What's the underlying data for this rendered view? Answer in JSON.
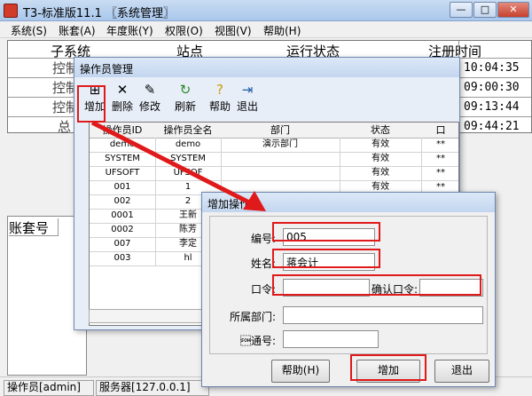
{
  "window": {
    "title": "T3-标准版11.1 〖系统管理〗",
    "min_label": "—",
    "max_label": "□",
    "close_label": "✕"
  },
  "menu": [
    "系统(S)",
    "账套(A)",
    "年度账(Y)",
    "权限(O)",
    "视图(V)",
    "帮助(H)"
  ],
  "main_table": {
    "headers": [
      "子系统",
      "站点",
      "运行状态",
      "注册时间"
    ],
    "row_labels": [
      "控制",
      "控制",
      "控制",
      "总"
    ],
    "times": [
      "10:04:35",
      "09:00:30",
      "09:13:44",
      "09:44:21"
    ]
  },
  "lower_table": {
    "header": "账套号"
  },
  "status_bar": {
    "operator": "操作员[admin]",
    "server": "服务器[127.0.0.1]"
  },
  "operator_dialog": {
    "title": "操作员管理",
    "toolbar": [
      {
        "label": "增加",
        "icon": "add-icon"
      },
      {
        "label": "删除",
        "icon": "delete-icon"
      },
      {
        "label": "修改",
        "icon": "edit-icon"
      },
      {
        "label": "刷新",
        "icon": "refresh-icon"
      },
      {
        "label": "帮助",
        "icon": "help-icon"
      },
      {
        "label": "退出",
        "icon": "exit-icon"
      }
    ],
    "columns": [
      "操作员ID",
      "操作员全名",
      "部门",
      "状态",
      "口"
    ],
    "rows": [
      [
        "demo",
        "demo",
        "演示部门",
        "有效",
        "**"
      ],
      [
        "SYSTEM",
        "SYSTEM",
        "",
        "有效",
        "**"
      ],
      [
        "UFSOFT",
        "UFSOF",
        "",
        "有效",
        "**"
      ],
      [
        "001",
        "1",
        "",
        "有效",
        "**"
      ],
      [
        "002",
        "2",
        "",
        "",
        ""
      ],
      [
        "0001",
        "王新",
        "",
        "",
        ""
      ],
      [
        "0002",
        "陈芳",
        "",
        "",
        ""
      ],
      [
        "007",
        "李定",
        "",
        "",
        ""
      ],
      [
        "003",
        "hl",
        "",
        "",
        ""
      ]
    ]
  },
  "add_dialog": {
    "title": "增加操作员",
    "fields": {
      "code_label": "编号:",
      "code_value": "005",
      "name_label": "姓名:",
      "name_value": "蒋会计",
      "password_label": "口令:",
      "password_value": "",
      "confirm_label": "确认口令:",
      "confirm_value": "",
      "dept_label": "所属部门:",
      "dept_value": "",
      "email_label": "\u0001通号:",
      "email_value": ""
    },
    "buttons": {
      "help": "帮助(H)",
      "add": "增加",
      "exit": "退出"
    }
  },
  "highlight_color": "#e0191a"
}
